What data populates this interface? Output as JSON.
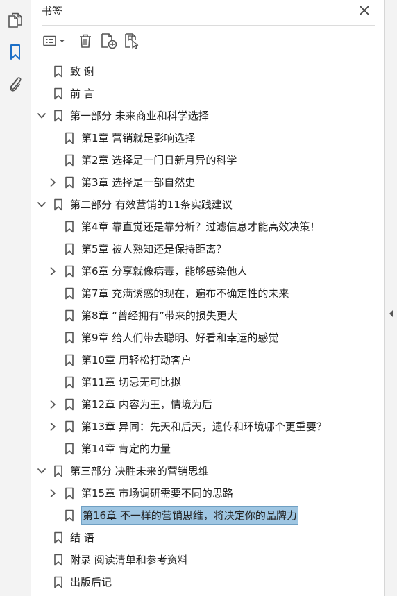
{
  "panel": {
    "title": "书签"
  },
  "icons": {
    "rail": [
      "pages-icon",
      "bookmark-icon",
      "paperclip-icon"
    ],
    "toolbar": [
      "options-menu-icon",
      "trash-icon",
      "new-bookmark-icon",
      "bookmark-from-selection-icon"
    ]
  },
  "colors": {
    "selection_fill": "#9fc6e2",
    "selection_border": "#6f9fc2",
    "active_rail_icon": "#1c6fc7"
  },
  "bookmarks": [
    {
      "text": "致 谢",
      "level": 0,
      "twisty": "none"
    },
    {
      "text": "前 言",
      "level": 0,
      "twisty": "none"
    },
    {
      "text": "第一部分 未来商业和科学选择",
      "level": 0,
      "twisty": "expanded"
    },
    {
      "text": "第1章 营销就是影响选择",
      "level": 1,
      "twisty": "none"
    },
    {
      "text": "第2章 选择是一门日新月异的科学",
      "level": 1,
      "twisty": "none"
    },
    {
      "text": "第3章 选择是一部自然史",
      "level": 1,
      "twisty": "collapsed"
    },
    {
      "text": "第二部分 有效营销的11条实践建议",
      "level": 0,
      "twisty": "expanded"
    },
    {
      "text": "第4章 靠直觉还是靠分析？过滤信息才能高效决策！",
      "level": 1,
      "twisty": "none"
    },
    {
      "text": "第5章 被人熟知还是保持距离？",
      "level": 1,
      "twisty": "none"
    },
    {
      "text": "第6章 分享就像病毒，能够感染他人",
      "level": 1,
      "twisty": "collapsed"
    },
    {
      "text": "第7章 充满诱惑的现在，遍布不确定性的未来",
      "level": 1,
      "twisty": "none"
    },
    {
      "text": "第8章 “曾经拥有”带来的损失更大",
      "level": 1,
      "twisty": "none"
    },
    {
      "text": "第9章 给人们带去聪明、好看和幸运的感觉",
      "level": 1,
      "twisty": "none"
    },
    {
      "text": "第10章 用轻松打动客户",
      "level": 1,
      "twisty": "none"
    },
    {
      "text": "第11章 切忌无可比拟",
      "level": 1,
      "twisty": "none"
    },
    {
      "text": "第12章 内容为王，情境为后",
      "level": 1,
      "twisty": "collapsed"
    },
    {
      "text": "第13章 异同：先天和后天，遗传和环境哪个更重要？",
      "level": 1,
      "twisty": "collapsed"
    },
    {
      "text": "第14章 肯定的力量",
      "level": 1,
      "twisty": "none"
    },
    {
      "text": "第三部分 决胜未来的营销思维",
      "level": 0,
      "twisty": "expanded"
    },
    {
      "text": "第15章 市场调研需要不同的思路",
      "level": 1,
      "twisty": "collapsed"
    },
    {
      "text": "第16章 不一样的营销思维，将决定你的品牌力",
      "level": 1,
      "twisty": "none",
      "selected": true
    },
    {
      "text": "结 语",
      "level": 0,
      "twisty": "none"
    },
    {
      "text": "附录 阅读清单和参考资料",
      "level": 0,
      "twisty": "none"
    },
    {
      "text": "出版后记",
      "level": 0,
      "twisty": "none"
    }
  ]
}
